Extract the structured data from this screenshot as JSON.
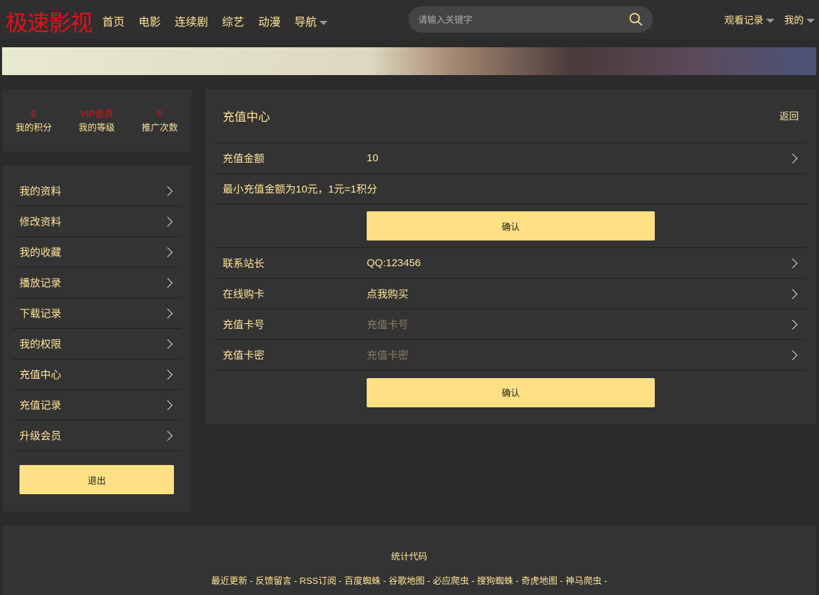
{
  "header": {
    "logo": "极速影视",
    "nav": [
      "首页",
      "电影",
      "连续剧",
      "综艺",
      "动漫",
      "导航"
    ],
    "search_placeholder": "请输入关键字",
    "history": "观看记录",
    "mine": "我的"
  },
  "stats": [
    {
      "value": "0",
      "label": "我的积分"
    },
    {
      "value": "VIP会员",
      "label": "我的等级"
    },
    {
      "value": "0",
      "label": "推广次数"
    }
  ],
  "menu": [
    "我的资料",
    "修改资料",
    "我的收藏",
    "播放记录",
    "下载记录",
    "我的权限",
    "充值中心",
    "充值记录",
    "升级会员"
  ],
  "logout": "退出",
  "main": {
    "title": "充值中心",
    "back": "返回",
    "amount_label": "充值金额",
    "amount_value": "10",
    "note": "最小充值金额为10元，1元=1积分",
    "confirm": "确认",
    "contact_label": "联系站长",
    "contact_value": "QQ:123456",
    "buy_label": "在线购卡",
    "buy_value": "点我购买",
    "card_label": "充值卡号",
    "card_placeholder": "充值卡号",
    "pwd_label": "充值卡密",
    "pwd_placeholder": "充值卡密"
  },
  "footer": {
    "stat": "统计代码",
    "links": "最近更新 - 反馈留言 - RSS订阅 - 百度蜘蛛 - 谷歌地图 - 必应爬虫 - 搜狗蜘蛛 - 奇虎地图 - 神马爬虫 -"
  }
}
